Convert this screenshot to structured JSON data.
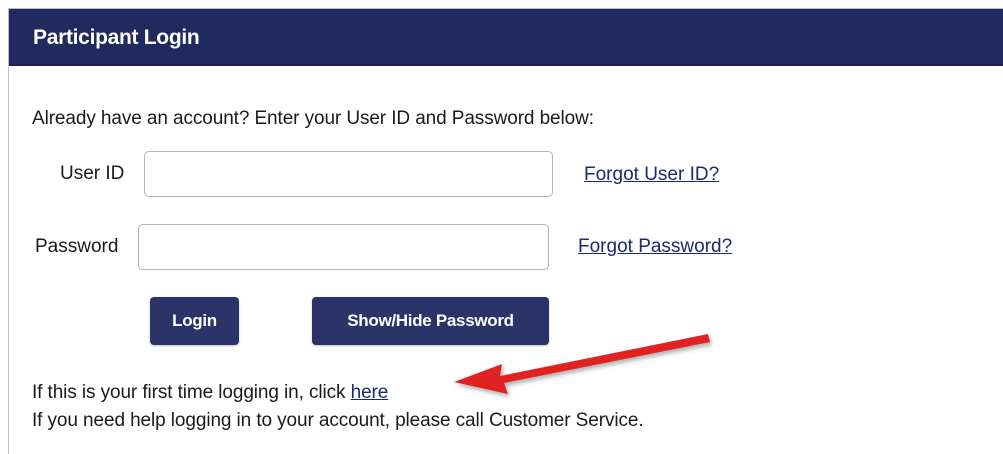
{
  "header": {
    "title": "Participant Login"
  },
  "form": {
    "intro": "Already have an account? Enter your User ID and Password below:",
    "user_id_label": "User ID",
    "user_id_value": "",
    "password_label": "Password",
    "password_value": "",
    "forgot_user_id": "Forgot User ID?",
    "forgot_password": "Forgot Password?",
    "login_button": "Login",
    "show_hide_button": "Show/Hide Password"
  },
  "footer": {
    "first_time_text": "If this is your first time logging in, click ",
    "first_time_link": "here",
    "help_text": "If you need help logging in to your account, please call Customer Service."
  },
  "annotation": {
    "arrow_color": "#e02020",
    "arrow_icon": "red-arrow-icon"
  },
  "colors": {
    "header_bg": "#212a5e",
    "button_bg": "#2b3469",
    "link_color": "#1a2a6c"
  }
}
